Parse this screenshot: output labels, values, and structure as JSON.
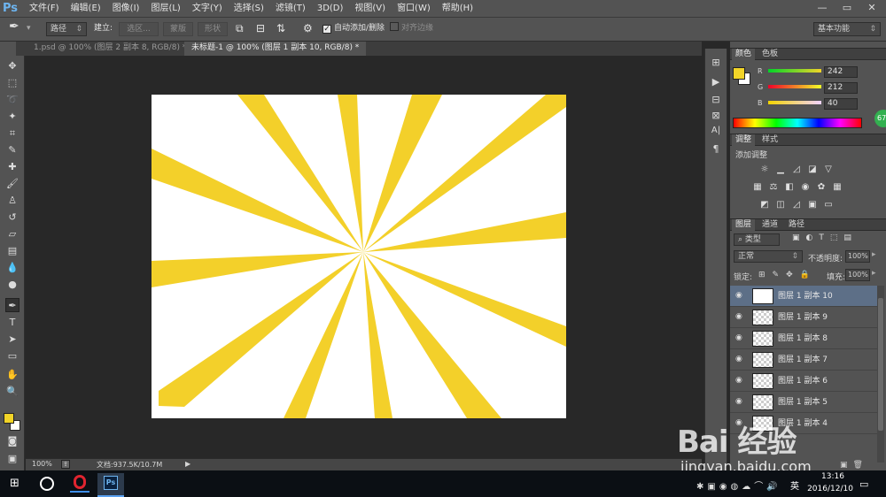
{
  "app": {
    "logo": "Ps"
  },
  "menu": [
    "文件(F)",
    "编辑(E)",
    "图像(I)",
    "图层(L)",
    "文字(Y)",
    "选择(S)",
    "滤镜(T)",
    "3D(D)",
    "视图(V)",
    "窗口(W)",
    "帮助(H)"
  ],
  "window_controls": {
    "minimize": "—",
    "restore": "▭",
    "close": "✕"
  },
  "options": {
    "mode": "路径",
    "make_label": "建立:",
    "selection_btn": "选区...",
    "mask_btn": "蒙版",
    "shape_btn": "形状",
    "auto_add_delete": "自动添加/删除",
    "auto_add_checked": true,
    "align_edges": "对齐边缘",
    "workspace": "基本功能"
  },
  "tabs": [
    {
      "label": "1.psd @ 100% (图层 2 副本 8, RGB/8) *",
      "active": false
    },
    {
      "label": "未标题-1 @ 100% (图层 1 副本 10, RGB/8) *",
      "active": true
    }
  ],
  "canvas": {
    "background": "#ffffff",
    "ray_color": "#f3d02a",
    "ray_count": 12
  },
  "status": {
    "zoom": "100%",
    "doc": "文档:937.5K/10.7M"
  },
  "color_panel": {
    "tabs": [
      "颜色",
      "色板"
    ],
    "foreground": "#f2d428",
    "R": {
      "label": "R",
      "value": "242"
    },
    "G": {
      "label": "G",
      "value": "212"
    },
    "B": {
      "label": "B",
      "value": "40"
    }
  },
  "adjust_panel": {
    "tabs": [
      "调整",
      "样式"
    ],
    "title": "添加调整"
  },
  "layers_panel": {
    "tabs": [
      "图层",
      "通道",
      "路径"
    ],
    "filter": "类型",
    "blend": "正常",
    "opacity_label": "不透明度:",
    "opacity": "100%",
    "lock_label": "锁定:",
    "fill_label": "填充:",
    "fill": "100%",
    "layers": [
      {
        "name": "图层 1 副本 10",
        "selected": true
      },
      {
        "name": "图层 1 副本 9",
        "selected": false
      },
      {
        "name": "图层 1 副本 8",
        "selected": false
      },
      {
        "name": "图层 1 副本 7",
        "selected": false
      },
      {
        "name": "图层 1 副本 6",
        "selected": false
      },
      {
        "name": "图层 1 副本 5",
        "selected": false
      },
      {
        "name": "图层 1 副本 4",
        "selected": false
      }
    ]
  },
  "taskbar": {
    "time": "13:16",
    "date": "2016/12/10",
    "ime": "英"
  },
  "watermark": {
    "brand": "Bai 经验",
    "url": "jingyan.baidu.com"
  },
  "badge": "67"
}
